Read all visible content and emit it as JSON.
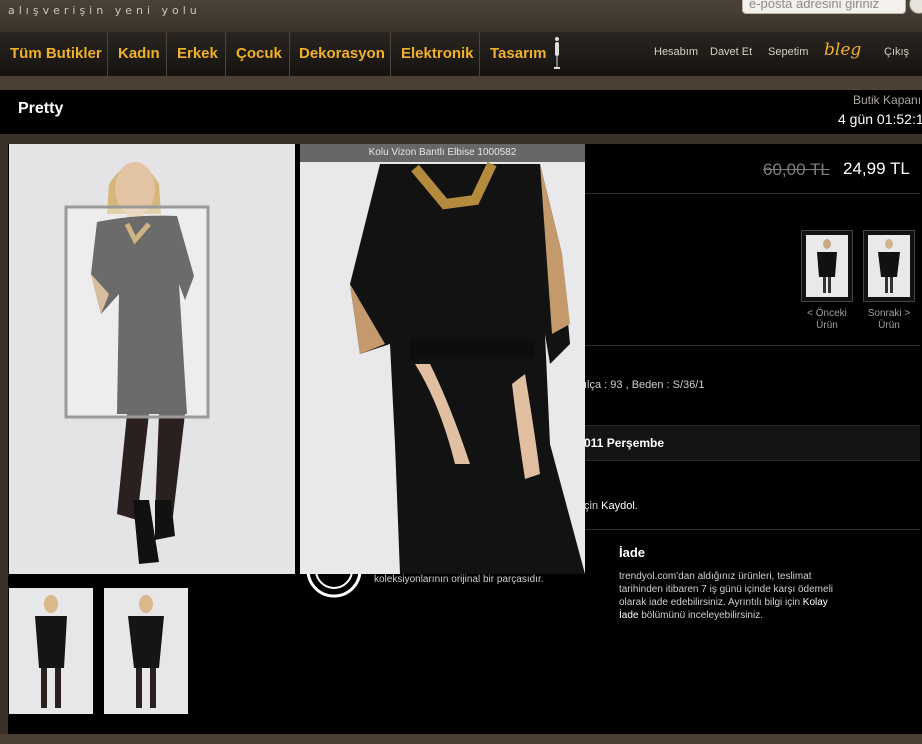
{
  "header": {
    "tagline": "alışverişin yeni yolu",
    "search_placeholder": "e-posta adresini giriniz"
  },
  "nav": {
    "items": [
      "Tüm Butikler",
      "Kadın",
      "Erkek",
      "Çocuk",
      "Dekorasyon",
      "Elektronik",
      "Tasarım"
    ],
    "right": {
      "account": "Hesabım",
      "invite": "Davet Et",
      "cart": "Sepetim",
      "bleg": "bleg",
      "logout": "Çıkış"
    }
  },
  "boutique": {
    "name": "Pretty",
    "closing_label": "Butik Kapanı",
    "countdown": "4 gün 01:52:1"
  },
  "product": {
    "caption": "Kolu Vizon Bantlı Elbise 1000582",
    "old_price": "60,00 TL",
    "new_price": "24,99 TL",
    "prev_label": "< Önceki Ürün",
    "next_label": "Sonraki > Ürün",
    "sizes": "ılça : 93 , Beden : S/36/1",
    "date": "011 Perşembe",
    "kaydol_prefix": "çin ",
    "kaydol_link": "Kaydol",
    "kaydol_suffix": ".",
    "collection_text": "koleksiyonlarının orijinal bir parçasıdır."
  },
  "iade": {
    "title": "İade",
    "text": "trendyol.com'dan aldığınız ürünleri, teslimat tarihinden itibaren 7 iş günü içinde karşı ödemeli olarak iade edebilirsiniz. Ayrıntılı bilgi için ",
    "link": "Kolay İade",
    "suffix": " bölümünü inceleyebilirsiniz."
  },
  "colors": {
    "accent": "#f0b02a",
    "bg": "#000000",
    "frame": "#3a3229"
  }
}
